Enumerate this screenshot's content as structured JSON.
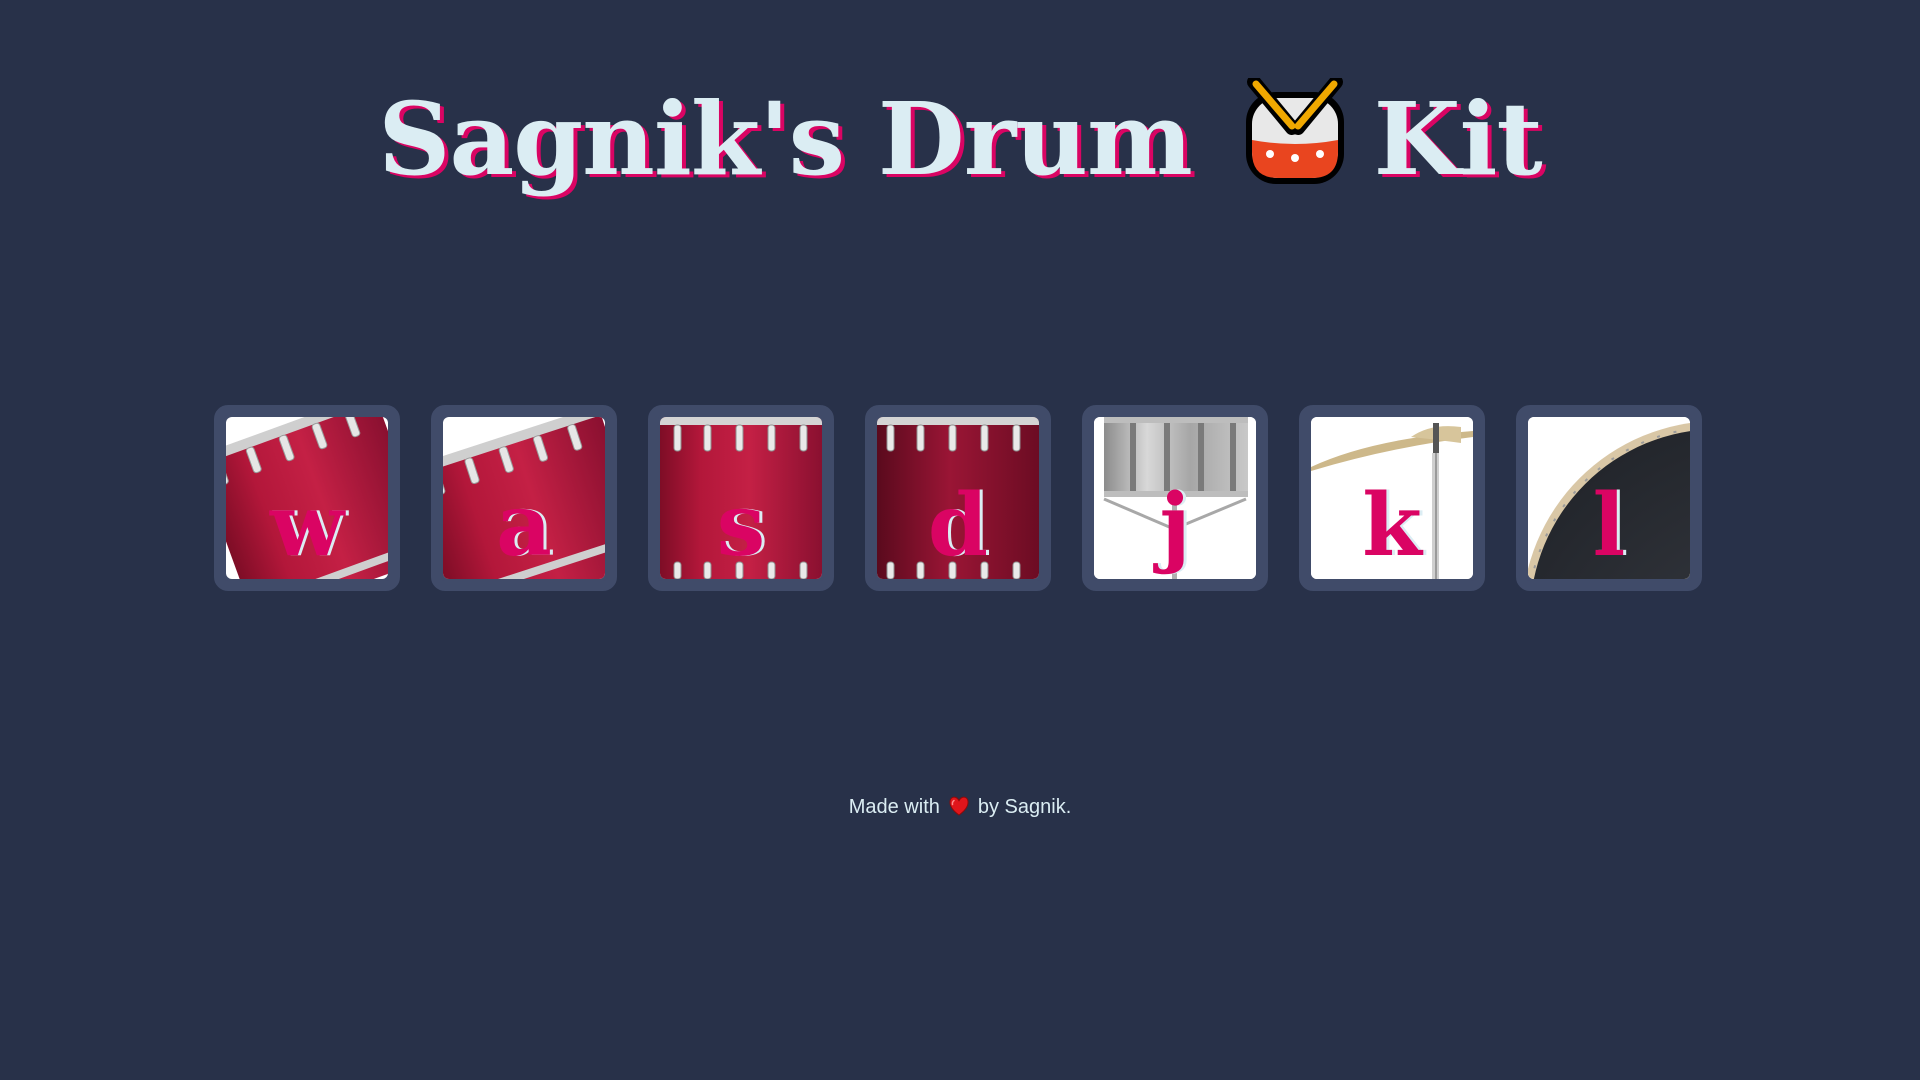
{
  "header": {
    "title_part1": "Sagnik's Drum",
    "title_icon": "drum-emoji",
    "title_part2": "Kit"
  },
  "colors": {
    "background": "#283149",
    "tile_border": "#404b69",
    "title_text": "#dbedf3",
    "accent": "#da0463"
  },
  "drums": [
    {
      "key": "w",
      "image": "tom-1"
    },
    {
      "key": "a",
      "image": "tom-2"
    },
    {
      "key": "s",
      "image": "tom-3"
    },
    {
      "key": "d",
      "image": "tom-4"
    },
    {
      "key": "j",
      "image": "snare"
    },
    {
      "key": "k",
      "image": "crash"
    },
    {
      "key": "l",
      "image": "kick-bass"
    }
  ],
  "footer": {
    "text_before": "Made with",
    "icon": "heart-icon",
    "text_after": "by Sagnik."
  }
}
